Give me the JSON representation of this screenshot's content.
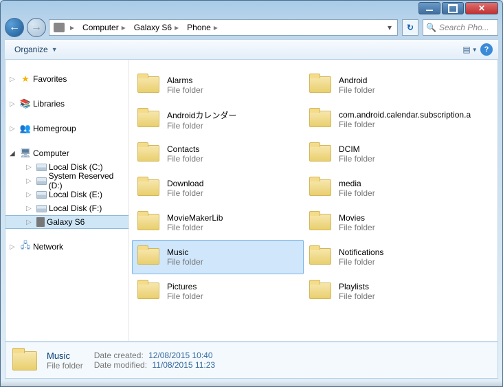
{
  "breadcrumb": [
    "Computer",
    "Galaxy S6",
    "Phone"
  ],
  "search": {
    "placeholder": "Search Pho..."
  },
  "toolbar": {
    "organize": "Organize"
  },
  "tree": {
    "favorites": "Favorites",
    "libraries": "Libraries",
    "homegroup": "Homegroup",
    "computer": "Computer",
    "drives": [
      {
        "name": "Local Disk (C:)",
        "type": "drive"
      },
      {
        "name": "System Reserved (D:)",
        "type": "drive"
      },
      {
        "name": "Local Disk (E:)",
        "type": "drive"
      },
      {
        "name": "Local Disk (F:)",
        "type": "drive"
      },
      {
        "name": "Galaxy S6",
        "type": "phone",
        "selected": true
      }
    ],
    "network": "Network"
  },
  "folders": [
    {
      "name": "Alarms",
      "sub": "File folder"
    },
    {
      "name": "Android",
      "sub": "File folder"
    },
    {
      "name": "Androidカレンダー",
      "sub": "File folder"
    },
    {
      "name": "com.android.calendar.subscription.a",
      "sub": "File folder"
    },
    {
      "name": "Contacts",
      "sub": "File folder"
    },
    {
      "name": "DCIM",
      "sub": "File folder"
    },
    {
      "name": "Download",
      "sub": "File folder"
    },
    {
      "name": "media",
      "sub": "File folder"
    },
    {
      "name": "MovieMakerLib",
      "sub": "File folder"
    },
    {
      "name": "Movies",
      "sub": "File folder"
    },
    {
      "name": "Music",
      "sub": "File folder",
      "selected": true
    },
    {
      "name": "Notifications",
      "sub": "File folder"
    },
    {
      "name": "Pictures",
      "sub": "File folder"
    },
    {
      "name": "Playlists",
      "sub": "File folder"
    }
  ],
  "details": {
    "name": "Music",
    "type": "File folder",
    "created_label": "Date created:",
    "created_value": "12/08/2015 10:40",
    "modified_label": "Date modified:",
    "modified_value": "11/08/2015 11:23"
  }
}
